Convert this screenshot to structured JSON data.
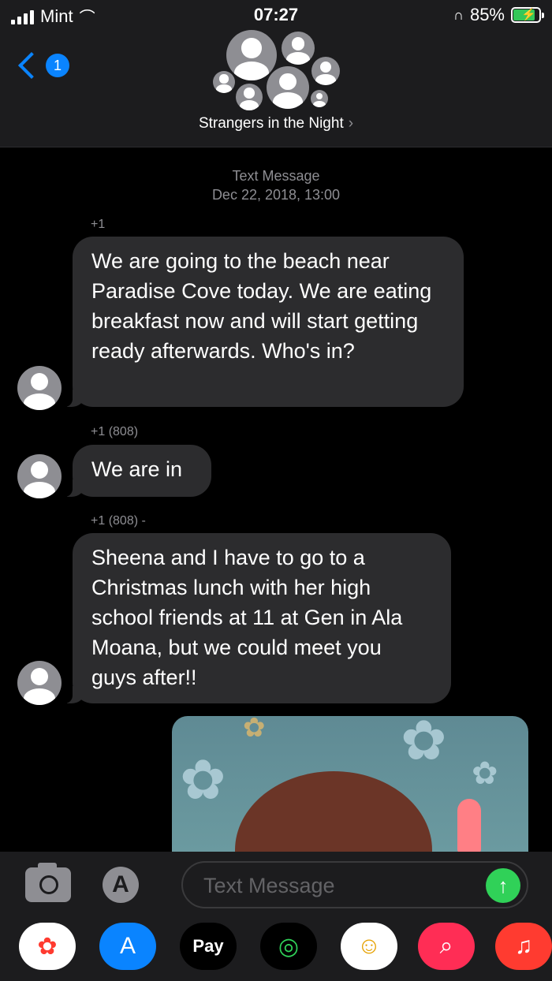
{
  "status": {
    "carrier": "Mint",
    "time": "07:27",
    "battery": "85%",
    "battery_level": 0.85,
    "colors": {
      "battery": "#34c759"
    }
  },
  "header": {
    "back_badge": "1",
    "group_name": "Strangers in the Night",
    "chevron": "›"
  },
  "thread": {
    "service": "Text Message",
    "timestamp": "Dec 22, 2018, 13:00",
    "messages": [
      {
        "sender": "+1",
        "text": "We are going to the beach near Paradise Cove today. We are eating breakfast now and will start getting ready afterwards. Who's in?"
      },
      {
        "sender": "+1 (808)",
        "text": "We are in"
      },
      {
        "sender": "+1 (808) -",
        "text": "Sheena and I have to go to a Christmas lunch with her high school friends at 11 at Gen in Ala Moana, but we could meet you guys after!!"
      }
    ]
  },
  "composer": {
    "placeholder": "Text Message",
    "send_icon": "↑",
    "apps_icon": "A"
  },
  "app_drawer": {
    "items": [
      {
        "name": "photos",
        "icon": "✿",
        "bg": "#ffffff",
        "fg": "#ff3b30"
      },
      {
        "name": "app-store",
        "icon": "A",
        "bg": "#0a84ff",
        "fg": "#ffffff"
      },
      {
        "name": "apple-pay",
        "icon": "Pay",
        "bg": "#000000",
        "fg": "#ffffff"
      },
      {
        "name": "activity",
        "icon": "◎",
        "bg": "#000000",
        "fg": "#30d158"
      },
      {
        "name": "memoji",
        "icon": "☺",
        "bg": "#ffffff",
        "fg": "#e6a100"
      },
      {
        "name": "image-search",
        "icon": "⌕",
        "bg": "#ff2d55",
        "fg": "#ffffff"
      },
      {
        "name": "music",
        "icon": "♫",
        "bg": "#ff3b30",
        "fg": "#ffffff"
      }
    ]
  }
}
